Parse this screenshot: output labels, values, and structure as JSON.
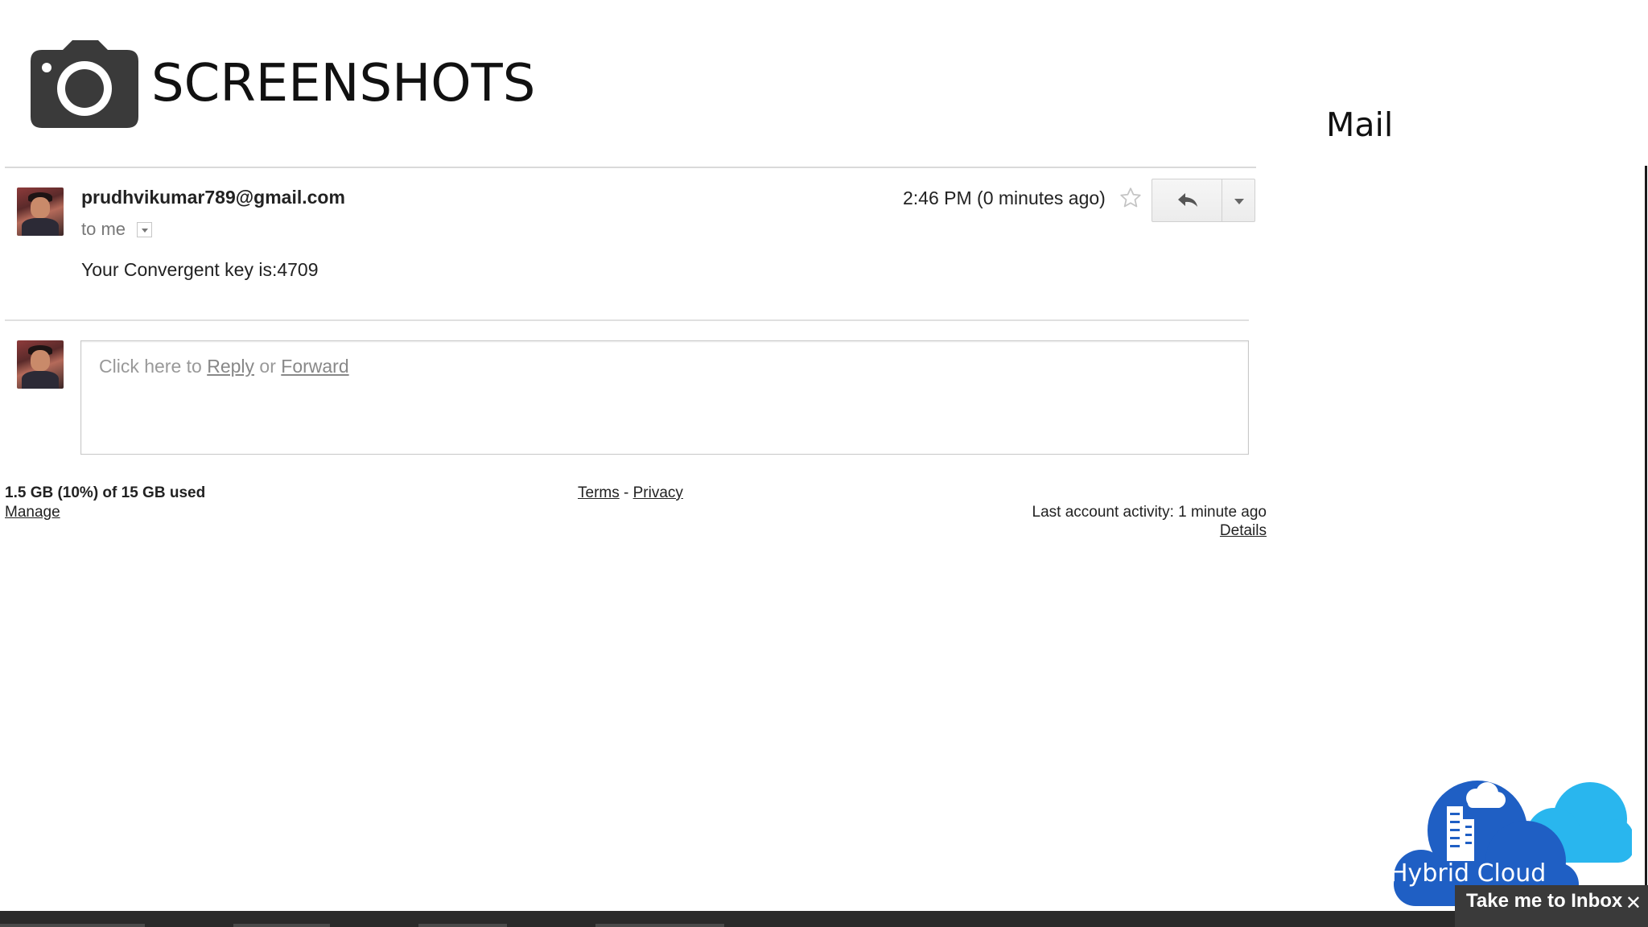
{
  "slide": {
    "title": "SCREENSHOTS",
    "subtitle": "Mail"
  },
  "message": {
    "sender": "prudhvikumar789@gmail.com",
    "recipient": "to me",
    "timestamp": "2:46 PM (0 minutes ago)",
    "body": "Your Convergent key is:4709"
  },
  "reply_box": {
    "prefix": "Click here to ",
    "reply_label": "Reply",
    "separator": " or ",
    "forward_label": "Forward"
  },
  "footer": {
    "quota": "1.5 GB (10%) of 15 GB used",
    "manage_label": "Manage",
    "terms_label": "Terms",
    "dash": "-",
    "privacy_label": "Privacy",
    "activity": "Last account activity: 1 minute ago",
    "details_label": "Details"
  },
  "logo": {
    "text": "Hybrid Cloud"
  },
  "banner": {
    "text": "Take me to Inbox",
    "close": "✕"
  },
  "icons": {
    "camera": "camera-icon",
    "star": "star-icon",
    "reply": "reply-arrow-icon",
    "more": "chevron-down-icon",
    "avatar": "avatar",
    "building": "building-icon"
  },
  "colors": {
    "logo_dark_blue": "#1f5fc4",
    "logo_light_blue": "#29b6ee",
    "camera": "#3a3a3a"
  }
}
